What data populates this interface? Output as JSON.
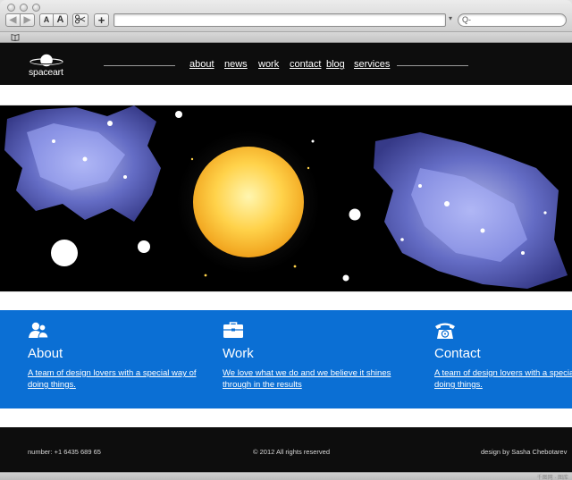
{
  "browser": {
    "back_label": "◀",
    "forward_label": "▶",
    "zoom_small_label": "A",
    "zoom_large_label": "A",
    "snip_icon": "scissors-icon",
    "add_label": "+",
    "url_value": "",
    "url_arrow": "▾",
    "search_placeholder": "Q-",
    "bookmark_icon": "book-icon"
  },
  "site": {
    "brand": "spaceart",
    "nav": [
      {
        "label": "about"
      },
      {
        "label": "news"
      },
      {
        "label": "work"
      },
      {
        "label": "contact"
      },
      {
        "label": "blog"
      },
      {
        "label": "services"
      }
    ],
    "features": [
      {
        "icon": "people-icon",
        "title": "About",
        "description": "A team of design lovers with a special way of doing things."
      },
      {
        "icon": "briefcase-icon",
        "title": "Work",
        "description": "We love what we do and we believe it shines through in the results"
      },
      {
        "icon": "telephone-icon",
        "title": "Contact",
        "description": "A team of design lovers with a special way of doing things."
      }
    ],
    "footer": {
      "phone": "number: +1 6435 689 65",
      "copyright": "© 2012 All rights reserved",
      "credit": "design by Sasha Chebotarev"
    }
  },
  "watermark": "千图网 · 图库",
  "colors": {
    "header_bg": "#0d0d0d",
    "feature_blue": "#0b6fd4",
    "sun_yellow": "#ffd24a",
    "nebula_blue": "#5a63c8"
  }
}
